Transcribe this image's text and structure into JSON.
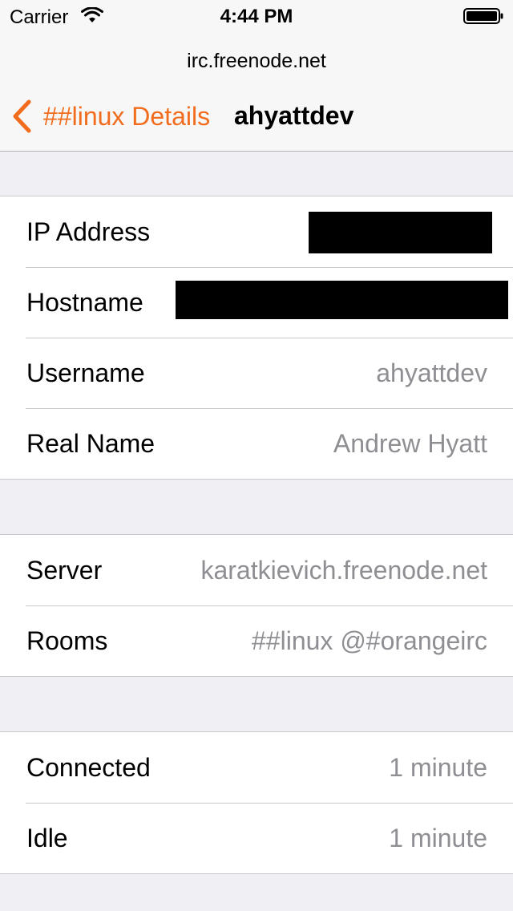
{
  "status_bar": {
    "carrier": "Carrier",
    "time": "4:44 PM"
  },
  "nav": {
    "subtitle": "irc.freenode.net",
    "back_label": "##linux Details",
    "title": "ahyattdev",
    "accent_color": "#f26c1d"
  },
  "user_info": {
    "ip_address": {
      "label": "IP Address",
      "value": ""
    },
    "hostname": {
      "label": "Hostname",
      "value": ""
    },
    "username": {
      "label": "Username",
      "value": "ahyattdev"
    },
    "real_name": {
      "label": "Real Name",
      "value": "Andrew Hyatt"
    }
  },
  "server_info": {
    "server": {
      "label": "Server",
      "value": "karatkievich.freenode.net"
    },
    "rooms": {
      "label": "Rooms",
      "value": "##linux @#orangeirc"
    }
  },
  "activity": {
    "connected": {
      "label": "Connected",
      "value": "1 minute"
    },
    "idle": {
      "label": "Idle",
      "value": "1 minute"
    }
  },
  "icons": [
    "wifi-icon",
    "battery-icon",
    "chevron-left-icon"
  ]
}
